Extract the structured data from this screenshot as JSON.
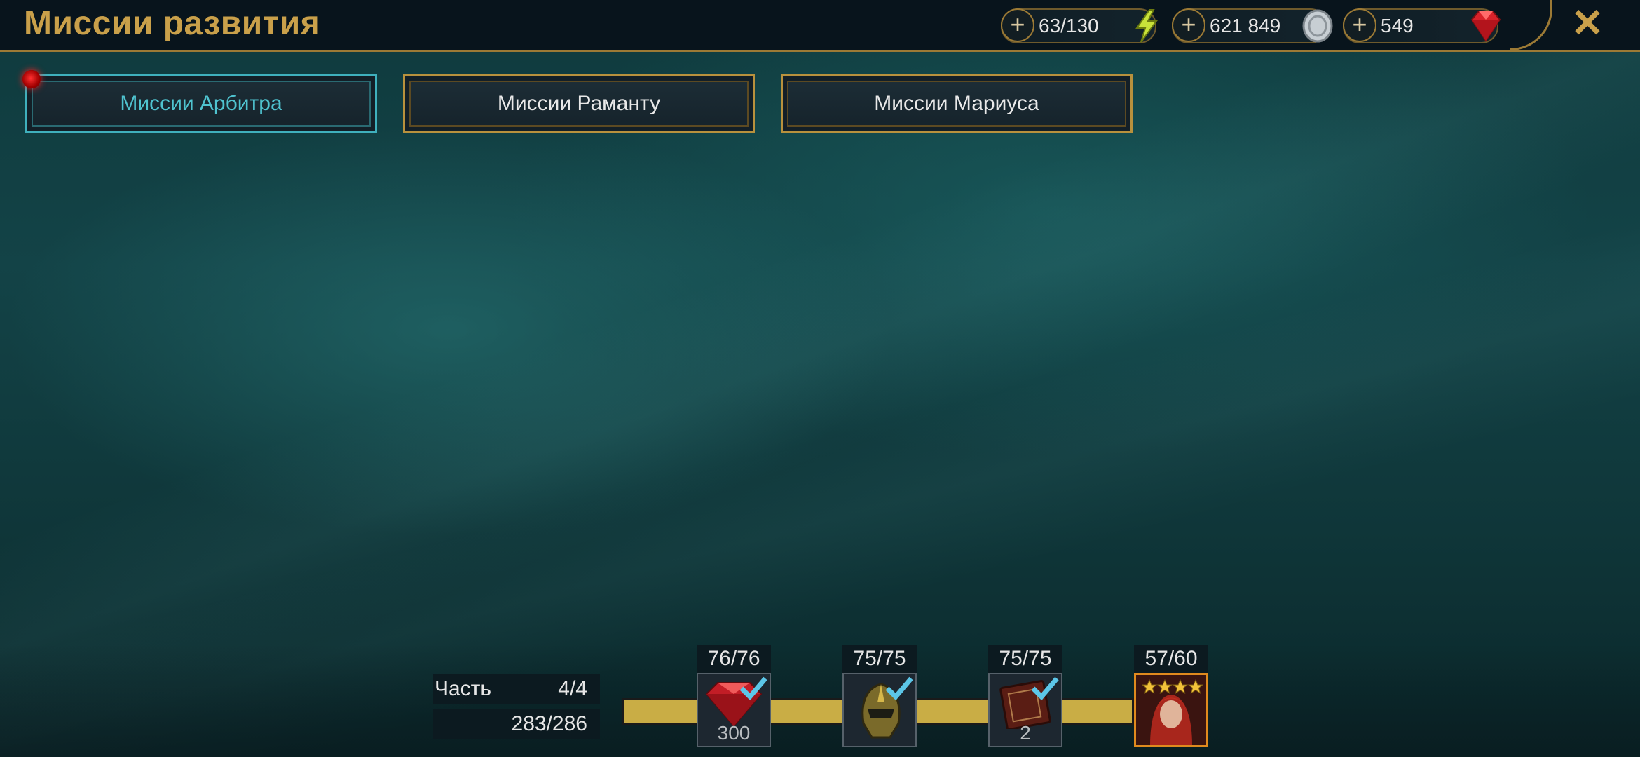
{
  "header": {
    "title": "Миссии развития",
    "resources": [
      {
        "name": "energy",
        "value": "63/130",
        "icon": "lightning-icon"
      },
      {
        "name": "silver",
        "value": "621 849",
        "icon": "silver-coin-icon"
      },
      {
        "name": "gems",
        "value": "549",
        "icon": "ruby-gem-icon"
      }
    ],
    "close_icon": "close-icon"
  },
  "tabs": [
    {
      "label": "Миссии Арбитра",
      "active": true,
      "has_notification": true
    },
    {
      "label": "Миссии Раманту",
      "active": false
    },
    {
      "label": "Миссии Мариуса",
      "active": false
    }
  ],
  "progress": {
    "part_label": "Часть",
    "part_value": "4/4",
    "points": "283/286",
    "milestones": [
      {
        "count": "76/76",
        "reward_icon": "ruby-gem-icon",
        "quantity": "300",
        "completed": true
      },
      {
        "count": "75/75",
        "reward_icon": "champion-helmet-icon",
        "quantity": "",
        "completed": true
      },
      {
        "count": "75/75",
        "reward_icon": "book-icon",
        "quantity": "2",
        "completed": true
      },
      {
        "count": "57/60",
        "reward_icon": "champion-portrait-icon",
        "stars": 4,
        "completed": false
      }
    ]
  },
  "colors": {
    "gold": "#c9a04a",
    "active_tab": "#4fc3cf",
    "progress_fill": "#c9ad45"
  }
}
